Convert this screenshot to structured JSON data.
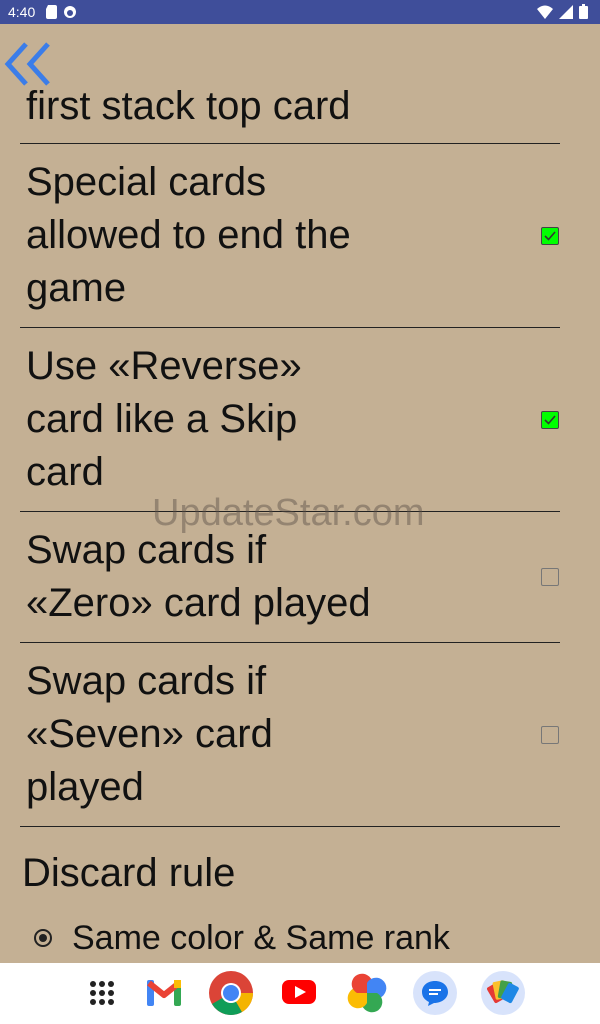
{
  "status_bar": {
    "time": "4:40"
  },
  "back_button": {
    "icon": "double-chevron-left-icon",
    "color": "#3b7de9"
  },
  "partial_row": {
    "text": "first stack top card"
  },
  "rows": [
    {
      "label": "Special cards\nallowed to end the\ngame",
      "checked": true
    },
    {
      "label": "Use «Reverse»\ncard like a Skip\ncard",
      "checked": true
    },
    {
      "label": "Swap cards if\n«Zero» card played",
      "checked": false
    },
    {
      "label": "Swap cards if\n«Seven» card\nplayed",
      "checked": false
    }
  ],
  "section": {
    "title": "Discard rule"
  },
  "radio_options": [
    {
      "label": "Same color & Same rank",
      "selected": true
    }
  ],
  "watermark": "UpdateStar.com",
  "dock": {
    "items": [
      {
        "name": "app-drawer",
        "icon": "grid-icon"
      },
      {
        "name": "gmail",
        "icon": "gmail-icon"
      },
      {
        "name": "chrome",
        "icon": "chrome-icon"
      },
      {
        "name": "youtube",
        "icon": "youtube-icon"
      },
      {
        "name": "photos",
        "icon": "photos-icon"
      },
      {
        "name": "messages",
        "icon": "messages-icon"
      },
      {
        "name": "cards-game",
        "icon": "cards-game-icon"
      }
    ]
  },
  "colors": {
    "background": "#c4b094",
    "status_bar": "#3f4e9a",
    "checkbox_checked": "#00ff00",
    "accent": "#3b7de9"
  }
}
